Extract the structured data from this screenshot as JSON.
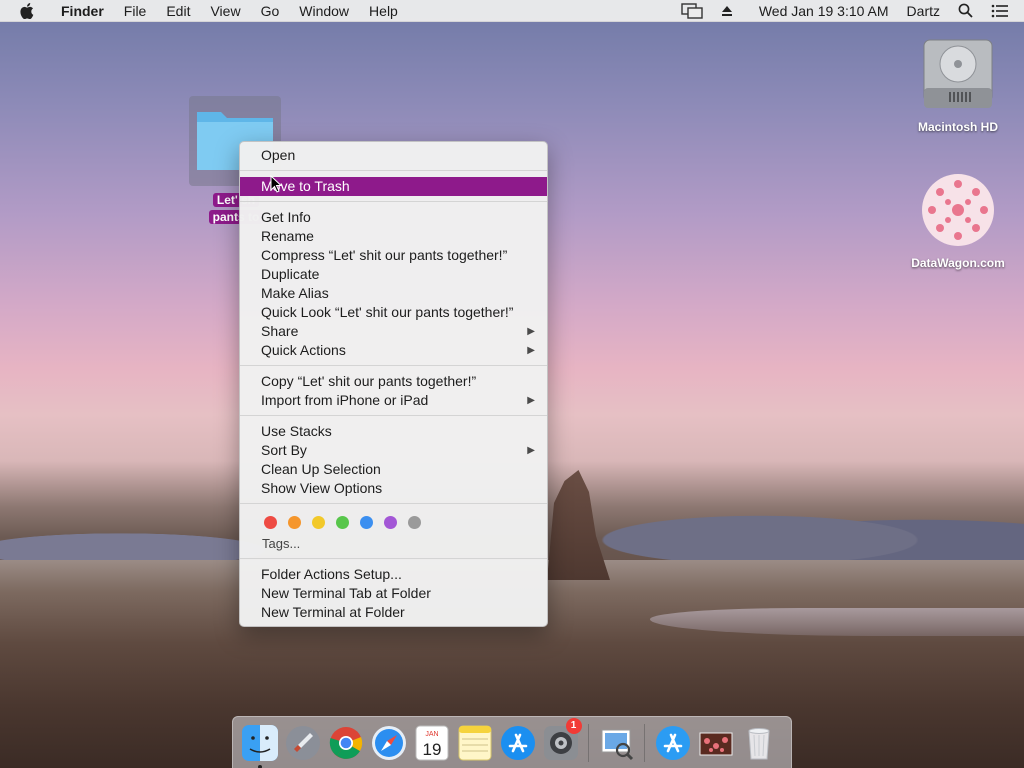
{
  "menubar": {
    "app_name": "Finder",
    "menus": [
      "File",
      "Edit",
      "View",
      "Go",
      "Window",
      "Help"
    ],
    "datetime": "Wed Jan 19  3:10 AM",
    "user": "Dartz"
  },
  "desktop": {
    "folder_label_line1": "Let' sh",
    "folder_label_line2": "pants to",
    "drive_label": "Macintosh HD",
    "wagon_label": "DataWagon.com"
  },
  "context_menu": {
    "open": "Open",
    "move_to_trash": "Move to Trash",
    "get_info": "Get Info",
    "rename": "Rename",
    "compress": "Compress “Let' shit our pants together!”",
    "duplicate": "Duplicate",
    "make_alias": "Make Alias",
    "quick_look": "Quick Look “Let' shit our pants together!”",
    "share": "Share",
    "quick_actions": "Quick Actions",
    "copy": "Copy “Let' shit our pants together!”",
    "import_iphone": "Import from iPhone or iPad",
    "use_stacks": "Use Stacks",
    "sort_by": "Sort By",
    "clean_up": "Clean Up Selection",
    "show_view_options": "Show View Options",
    "tags": "Tags...",
    "folder_actions": "Folder Actions Setup...",
    "new_terminal_tab": "New Terminal Tab at Folder",
    "new_terminal": "New Terminal at Folder",
    "tag_colors": [
      "#ee4b43",
      "#f5962c",
      "#f2c92a",
      "#58c64b",
      "#3b8ff0",
      "#a357d6",
      "#9a9a9a"
    ],
    "highlight_color": "#8e1a8b"
  },
  "dock": {
    "calendar_month": "JAN",
    "calendar_day": "19",
    "prefs_badge": "1"
  }
}
